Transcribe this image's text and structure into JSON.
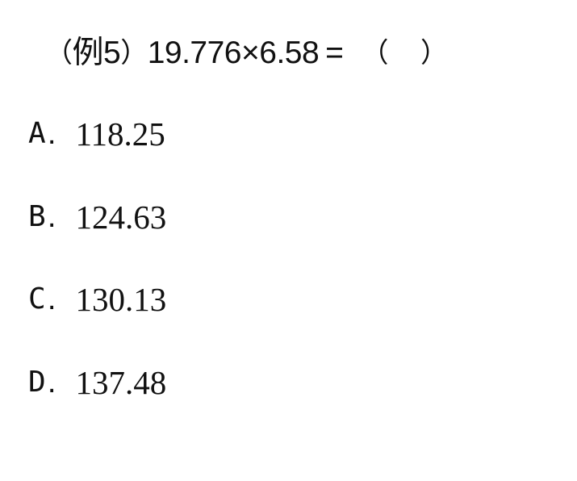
{
  "question": {
    "open_paren": "（",
    "label": "例5",
    "close_paren": "）",
    "expression": "19.776×6.58",
    "equals": "=",
    "answer_open": "（",
    "answer_close": "）"
  },
  "options": [
    {
      "letter": "A",
      "dot": ".",
      "value": "118.25"
    },
    {
      "letter": "B",
      "dot": ".",
      "value": "124.63"
    },
    {
      "letter": "C",
      "dot": ".",
      "value": "130.13"
    },
    {
      "letter": "D",
      "dot": ".",
      "value": "137.48"
    }
  ]
}
